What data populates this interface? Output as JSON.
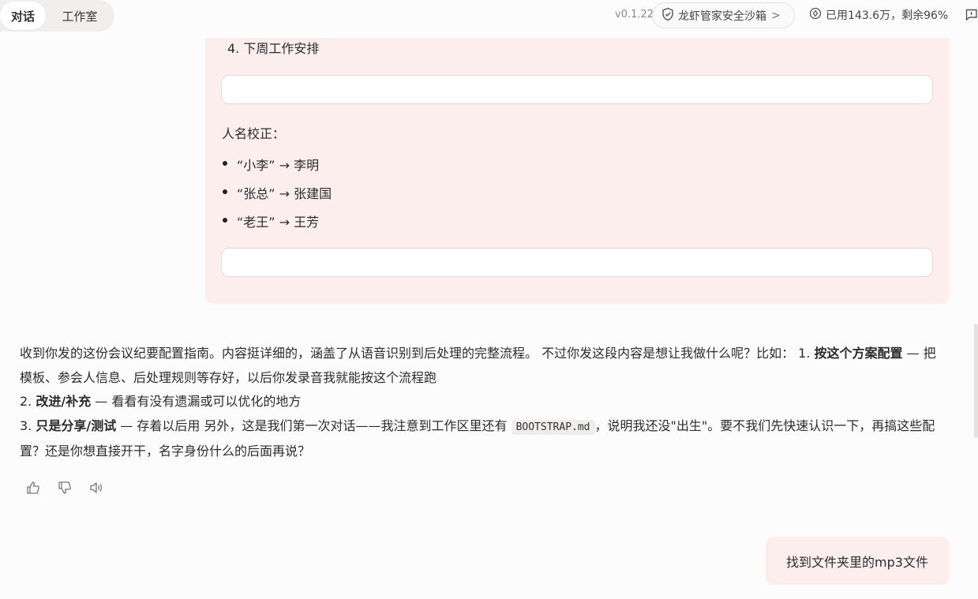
{
  "header": {
    "tabs": [
      {
        "label": "对话",
        "active": true
      },
      {
        "label": "工作室",
        "active": false
      }
    ],
    "version": "v0.1.22",
    "sandbox_label": "龙虾管家安全沙箱",
    "quota_label": "已用143.6万，剩余96%"
  },
  "message_top": {
    "list_item_4": "4. 下周工作安排",
    "names_heading": "人名校正：",
    "corrections": [
      "“小李” → 李明",
      "“张总” → 张建国",
      "“老王” → 王芳"
    ]
  },
  "assistant_reply": {
    "line1_text": "收到你发的这份会议纪要配置指南。内容挺详细的，涵盖了从语音识别到后处理的完整流程。 不过你发这段内容是想让我做什么呢？比如： 1. ",
    "item1_bold": "按这个方案配置",
    "item1_rest": " — 把模板、参会人信息、后处理规则等存好，以后你发录音我就能按这个流程跑",
    "item2_num": "2. ",
    "item2_bold": "改进/补充",
    "item2_rest": " — 看看有没有遗漏或可以优化的地方",
    "item3_num": "3. ",
    "item3_bold": "只是分享/测试",
    "item3_rest": " — 存着以后用 另外，这是我们第一次对话——我注意到工作区里还有 ",
    "code": "BOOTSTRAP.md",
    "tail": "，说明我还没\"出生\"。要不我们先快速认识一下，再搞这些配置？还是你想直接开干，名字身份什么的后面再说？"
  },
  "user_message": "找到文件夹里的mp3文件",
  "colors": {
    "bubble": "#fdeeee",
    "background": "#fdfcfc"
  }
}
